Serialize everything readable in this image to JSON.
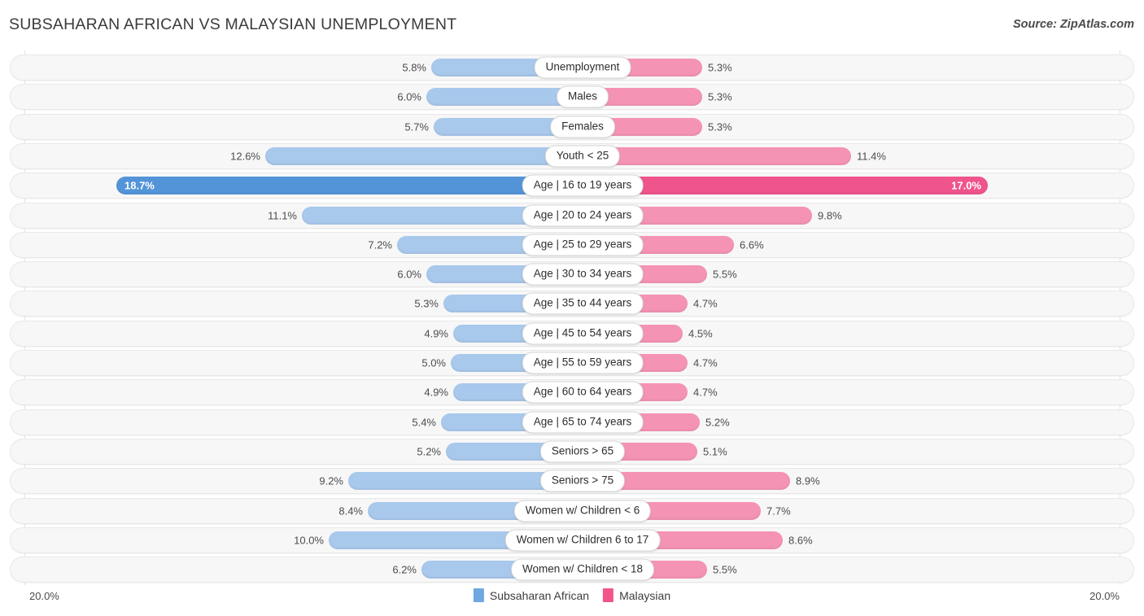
{
  "header": {
    "title": "SUBSAHARAN AFRICAN VS MALAYSIAN UNEMPLOYMENT",
    "source": "Source: ZipAtlas.com"
  },
  "axis": {
    "left_label": "20.0%",
    "right_label": "20.0%"
  },
  "legend": {
    "items": [
      {
        "label": "Subsaharan African",
        "color": "#6fa8e0"
      },
      {
        "label": "Malaysian",
        "color": "#f2548c"
      }
    ]
  },
  "colors": {
    "left_bar": "#a8c8ec",
    "right_bar": "#f593b4",
    "left_bar_highlight": "#5394d8",
    "right_bar_highlight": "#f0548c",
    "row_background": "#f7f7f7",
    "gridline": "#e3e3e3"
  },
  "chart_data": {
    "type": "bar",
    "title": "SUBSAHARAN AFRICAN VS MALAYSIAN UNEMPLOYMENT",
    "subtitle": "",
    "xlabel": "",
    "ylabel": "",
    "orientation": "horizontal-diverging",
    "axis_max": 20.0,
    "axis_unit": "%",
    "grid": true,
    "legend_position": "bottom-center",
    "categories": [
      "Unemployment",
      "Males",
      "Females",
      "Youth < 25",
      "Age | 16 to 19 years",
      "Age | 20 to 24 years",
      "Age | 25 to 29 years",
      "Age | 30 to 34 years",
      "Age | 35 to 44 years",
      "Age | 45 to 54 years",
      "Age | 55 to 59 years",
      "Age | 60 to 64 years",
      "Age | 65 to 74 years",
      "Seniors > 65",
      "Seniors > 75",
      "Women w/ Children < 6",
      "Women w/ Children 6 to 17",
      "Women w/ Children < 18"
    ],
    "series": [
      {
        "name": "Subsaharan African",
        "side": "left",
        "color": "#a8c8ec",
        "values": [
          5.8,
          6.0,
          5.7,
          12.6,
          18.7,
          11.1,
          7.2,
          6.0,
          5.3,
          4.9,
          5.0,
          4.9,
          5.4,
          5.2,
          9.2,
          8.4,
          10.0,
          6.2
        ],
        "labels": [
          "5.8%",
          "6.0%",
          "5.7%",
          "12.6%",
          "18.7%",
          "11.1%",
          "7.2%",
          "6.0%",
          "5.3%",
          "4.9%",
          "5.0%",
          "4.9%",
          "5.4%",
          "5.2%",
          "9.2%",
          "8.4%",
          "10.0%",
          "6.2%"
        ]
      },
      {
        "name": "Malaysian",
        "side": "right",
        "color": "#f593b4",
        "values": [
          5.3,
          5.3,
          5.3,
          11.4,
          17.0,
          9.8,
          6.6,
          5.5,
          4.7,
          4.5,
          4.7,
          4.7,
          5.2,
          5.1,
          8.9,
          7.7,
          8.6,
          5.5
        ],
        "labels": [
          "5.3%",
          "5.3%",
          "5.3%",
          "11.4%",
          "17.0%",
          "9.8%",
          "6.6%",
          "5.5%",
          "4.7%",
          "4.5%",
          "4.7%",
          "4.7%",
          "5.2%",
          "5.1%",
          "8.9%",
          "7.7%",
          "8.6%",
          "5.5%"
        ]
      }
    ],
    "highlighted_row": "Age | 16 to 19 years"
  }
}
